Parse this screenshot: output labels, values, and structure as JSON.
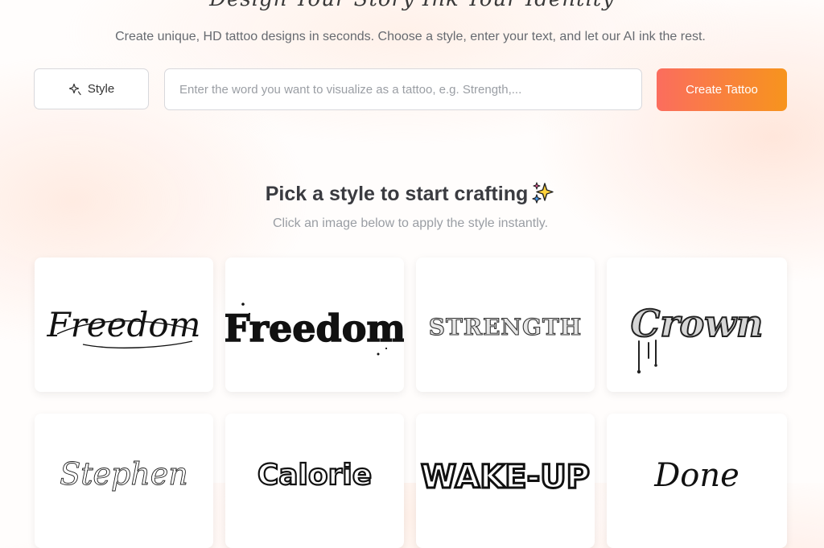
{
  "hero": {
    "tagline": "Design Your Story Ink Your Identity",
    "subtitle": "Create unique, HD tattoo designs in seconds. Choose a style, enter your text, and let our AI ink the rest."
  },
  "toolbar": {
    "style_label": "Style",
    "style_icon": "sparkle-icon",
    "input_placeholder": "Enter the word you want to visualize as a tattoo, e.g. Strength,...",
    "input_value": "",
    "create_label": "Create Tattoo"
  },
  "section": {
    "title": "Pick a style to start crafting",
    "title_icon": "sparkles-icon",
    "subtitle": "Click an image below to apply the style instantly."
  },
  "styles": [
    {
      "word": "Freedom",
      "look": "script"
    },
    {
      "word": "Freedom",
      "look": "blackletter"
    },
    {
      "word": "STRENGTH",
      "look": "engraved-serif"
    },
    {
      "word": "Crown",
      "look": "gothic-drip"
    },
    {
      "word": "Stephen",
      "look": "thin-script"
    },
    {
      "word": "Calorie",
      "look": "graffiti-outline"
    },
    {
      "word": "WAKE-UP",
      "look": "bold-marker"
    },
    {
      "word": "Done",
      "look": "script"
    }
  ],
  "colors": {
    "accent_start": "#fb6d5e",
    "accent_end": "#f7941d",
    "heading": "#3a3b40",
    "muted": "#9a9ea4"
  }
}
